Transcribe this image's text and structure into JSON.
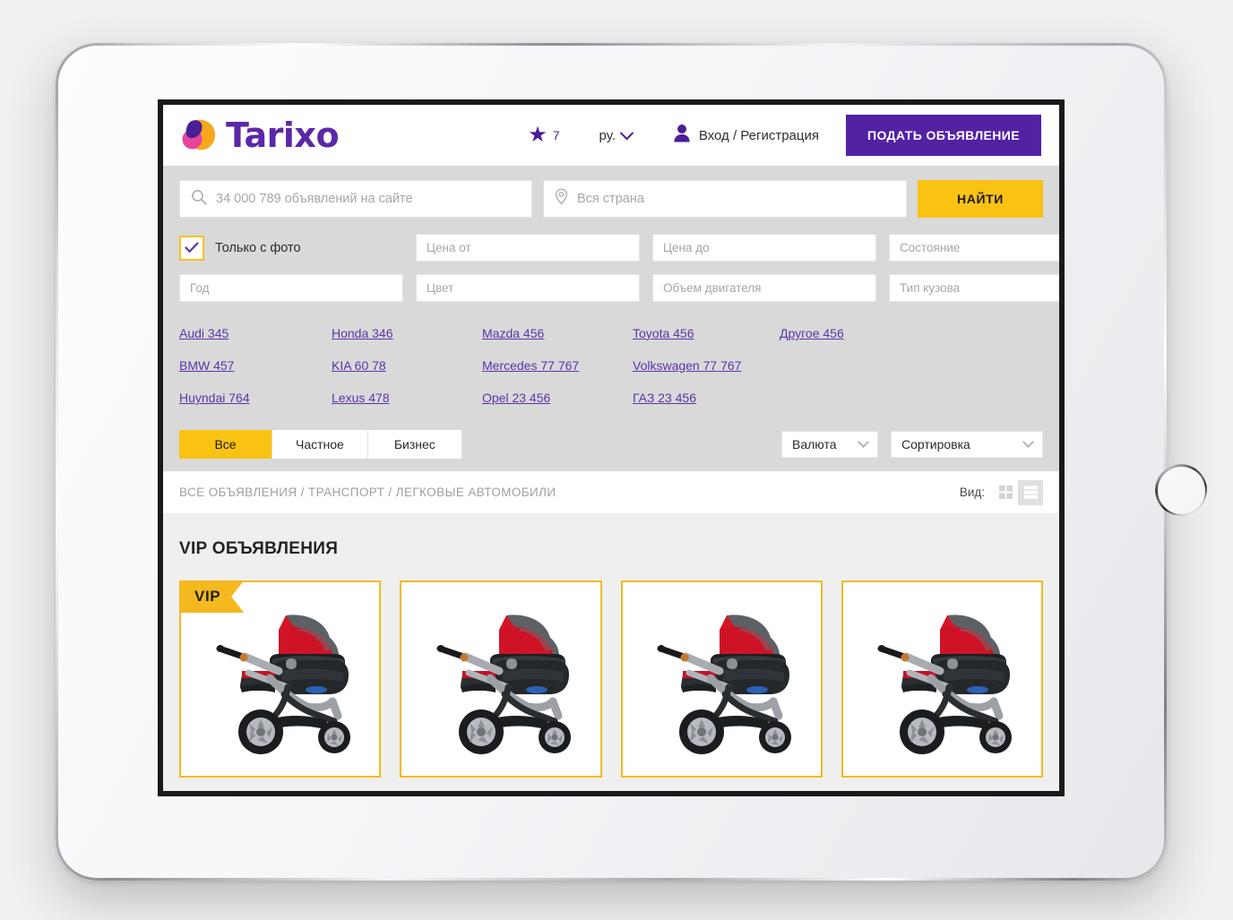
{
  "brand": {
    "logo_text": "Tarixo",
    "colors": {
      "purple": "#5322a3",
      "amber": "#fac213",
      "logo_orange": "#f5a81c",
      "logo_pink": "#e8449a",
      "logo_purple": "#4b1f96"
    }
  },
  "header": {
    "favorites_count": "7",
    "favorites_icon": "star-icon",
    "language": "ру.",
    "language_chevron_icon": "chevron-down-icon",
    "account_icon": "user-icon",
    "account_label": "Вход / Регистрация",
    "post_ad_button": "ПОДАТЬ ОБЪЯВЛЕНИЕ"
  },
  "search": {
    "query_icon": "search-icon",
    "query_placeholder": "34 000 789 объявлений на сайте",
    "query_value": "",
    "geo_icon": "location-pin-icon",
    "geo_placeholder": "Вся страна",
    "geo_value": "",
    "submit_label": "НАЙТИ"
  },
  "filters": {
    "photo_only": {
      "label": "Только с фото",
      "checked": true,
      "check_icon": "check-icon"
    },
    "fields": [
      {
        "name": "price-from",
        "placeholder": "Цена от",
        "value": ""
      },
      {
        "name": "price-to",
        "placeholder": "Цена до",
        "value": ""
      },
      {
        "name": "condition",
        "placeholder": "Состояние",
        "value": ""
      },
      {
        "name": "year",
        "placeholder": "Год",
        "value": ""
      },
      {
        "name": "color",
        "placeholder": "Цвет",
        "value": ""
      },
      {
        "name": "engine-volume",
        "placeholder": "Объем двигателя",
        "value": ""
      },
      {
        "name": "body-type",
        "placeholder": "Тип кузова",
        "value": ""
      }
    ]
  },
  "brands": [
    {
      "label": "Audi 345"
    },
    {
      "label": "Honda 346"
    },
    {
      "label": "Mazda 456"
    },
    {
      "label": "Toyota 456"
    },
    {
      "label": "Другое 456"
    },
    {
      "label": "BMW 457"
    },
    {
      "label": "KIA 60 78"
    },
    {
      "label": "Mercedes 77 767"
    },
    {
      "label": "Volkswagen 77 767"
    },
    {
      "label": ""
    },
    {
      "label": "Huyndai 764"
    },
    {
      "label": "Lexus 478"
    },
    {
      "label": "Opel 23 456"
    },
    {
      "label": "ГАЗ 23 456"
    },
    {
      "label": ""
    }
  ],
  "tabs": [
    {
      "label": "Все",
      "active": true
    },
    {
      "label": "Частное",
      "active": false
    },
    {
      "label": "Бизнес",
      "active": false
    }
  ],
  "selects": {
    "currency": {
      "label": "Валюта",
      "chevron_icon": "chevron-down-icon"
    },
    "sort": {
      "label": "Сортировка",
      "chevron_icon": "chevron-down-icon"
    }
  },
  "breadcrumb": {
    "text": "ВСЕ ОБЪЯВЛЕНИЯ / ТРАНСПОРТ / ЛЕГКОВЫЕ АВТОМОБИЛИ",
    "view_label": "Вид:",
    "grid_icon": "grid-view-icon",
    "list_icon": "list-view-icon",
    "active_view": "list"
  },
  "vip": {
    "section_title": "VIP ОБЪЯВЛЕНИЯ",
    "badge_label": "VIP",
    "cards": [
      {
        "name": "vip-card-1",
        "badge": true,
        "image_alt": "baby-stroller-photo"
      },
      {
        "name": "vip-card-2",
        "badge": false,
        "image_alt": "baby-stroller-photo"
      },
      {
        "name": "vip-card-3",
        "badge": false,
        "image_alt": "baby-stroller-photo"
      },
      {
        "name": "vip-card-4",
        "badge": false,
        "image_alt": "baby-stroller-photo"
      }
    ]
  }
}
